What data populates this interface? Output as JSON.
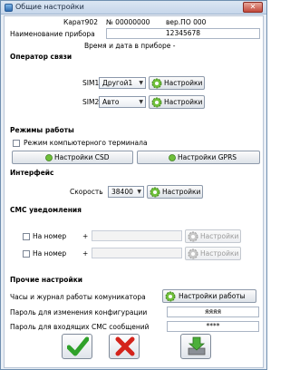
{
  "window": {
    "title": "Общие настройки",
    "close_glyph": "✕"
  },
  "device": {
    "model": "Карат902",
    "serial": "№ 00000000",
    "version": "вер.ПО 000",
    "name_label": "Наименование прибора",
    "name_value": "12345678",
    "datetime_text": "Время и дата в приборе -"
  },
  "operator": {
    "header": "Оператор связи",
    "sim1": {
      "label": "SIM1",
      "value": "Другой1",
      "button": "Настройки"
    },
    "sim2": {
      "label": "SIM2",
      "value": "Авто",
      "button": "Настройки"
    }
  },
  "modes": {
    "header": "Режимы работы",
    "terminal_checkbox": "Режим компьютерного терминала",
    "terminal_checked": false,
    "csd_button": "Настройки CSD",
    "gprs_button": "Настройки GPRS"
  },
  "interface": {
    "header": "Интерфейс",
    "speed_label": "Скорость",
    "speed_value": "38400",
    "button": "Настройки"
  },
  "sms": {
    "header": "СМС уведомления",
    "rows": [
      {
        "label": "На номер",
        "plus": "+",
        "value": "",
        "button": "Настройки",
        "checked": false
      },
      {
        "label": "На номер",
        "plus": "+",
        "value": "",
        "button": "Настройки",
        "checked": false
      }
    ]
  },
  "other": {
    "header": "Прочие настройки",
    "clock_label": "Часы и журнал работы комуникатора",
    "work_button": "Настройки работы",
    "config_pw_label": "Пароль для изменения конфигурации",
    "config_pw_value": "яяяя",
    "sms_pw_label": "Пароль для входящих СМС сообщений",
    "sms_pw_value": "****"
  },
  "icons": {
    "ok": "check-icon",
    "cancel": "cross-icon",
    "save": "download-icon",
    "settings": "gear-icon",
    "indicator": "green-dot-icon"
  },
  "colors": {
    "ok_green": "#2fa12a",
    "cancel_red": "#d4231b",
    "accent": "#3a8a2a"
  }
}
